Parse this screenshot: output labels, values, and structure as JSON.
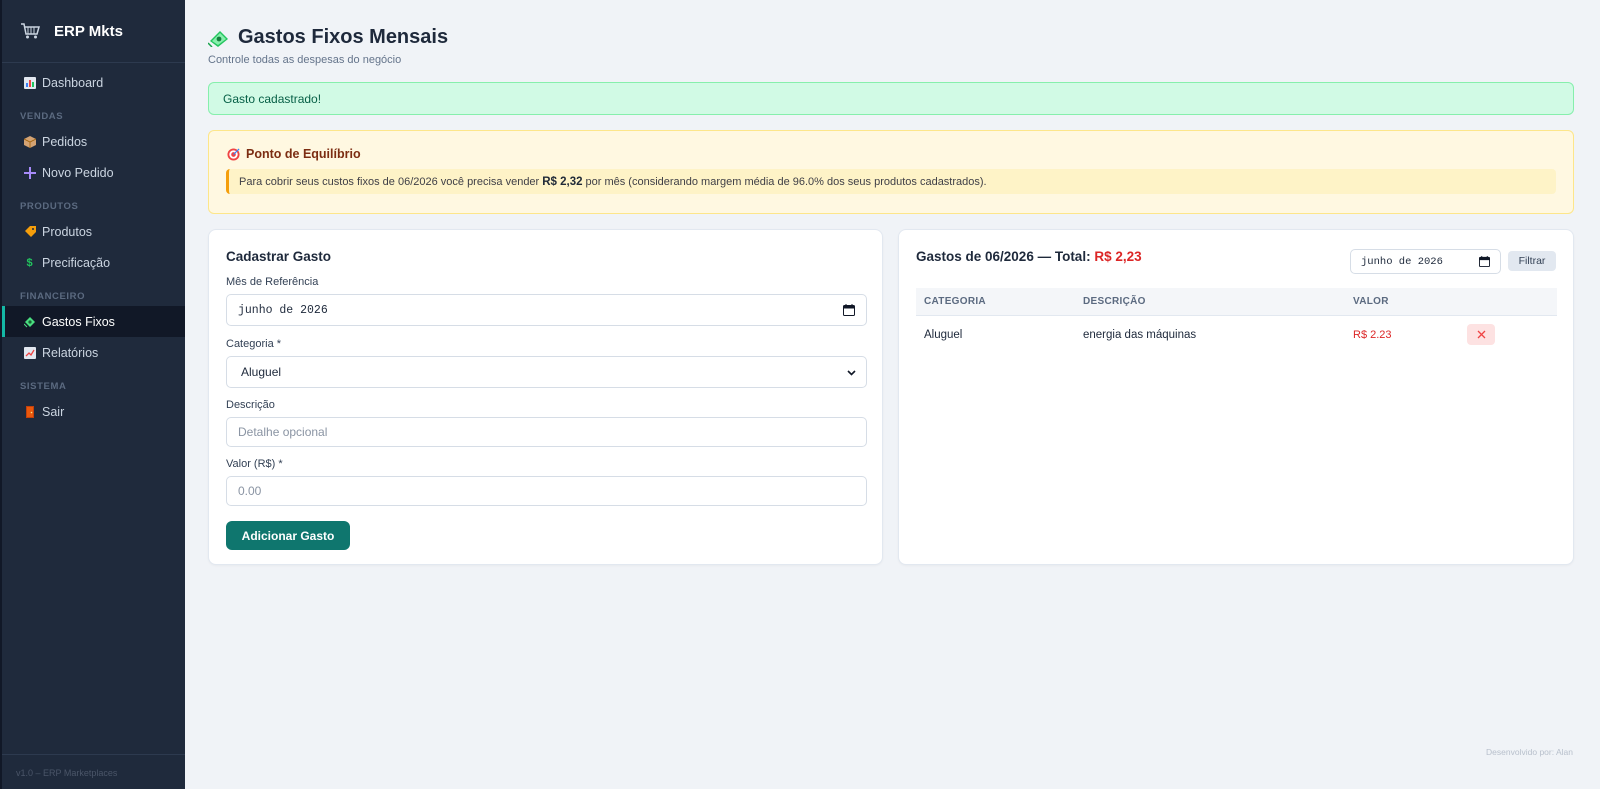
{
  "app": {
    "name": "ERP Mkts",
    "version": "v1.0 – ERP Marketplaces"
  },
  "sidebar": {
    "items": [
      {
        "label": "Dashboard",
        "icon": "chart-icon"
      },
      {
        "section": "VENDAS"
      },
      {
        "label": "Pedidos",
        "icon": "box-icon"
      },
      {
        "label": "Novo Pedido",
        "icon": "plus-icon"
      },
      {
        "section": "PRODUTOS"
      },
      {
        "label": "Produtos",
        "icon": "tag-icon"
      },
      {
        "label": "Precificação",
        "icon": "dollar-icon"
      },
      {
        "section": "FINANCEIRO"
      },
      {
        "label": "Gastos Fixos",
        "icon": "money-icon",
        "active": true
      },
      {
        "label": "Relatórios",
        "icon": "trend-icon"
      },
      {
        "section": "SISTEMA"
      },
      {
        "label": "Sair",
        "icon": "door-icon"
      }
    ]
  },
  "page": {
    "title": "Gastos Fixos Mensais",
    "subtitle": "Controle todas as despesas do negócio"
  },
  "alert": {
    "message": "Gasto cadastrado!"
  },
  "breakeven": {
    "title": "Ponto de Equilíbrio",
    "text_before": "Para cobrir seus custos fixos de 06/2026 você precisa vender",
    "amount": "R$ 2,32",
    "text_after": "por mês (considerando margem média de 96.0% dos seus produtos cadastrados)."
  },
  "form": {
    "title": "Cadastrar Gasto",
    "month_label": "Mês de Referência",
    "month_value": "junho de 2026",
    "category_label": "Categoria *",
    "category_value": "Aluguel",
    "description_label": "Descrição",
    "description_placeholder": "Detalhe opcional",
    "value_label": "Valor (R$) *",
    "value_placeholder": "0.00",
    "submit_label": "Adicionar Gasto"
  },
  "list": {
    "title_prefix": "Gastos de 06/2026 — Total:",
    "total": "R$ 2,23",
    "filter_date": "junho de 2026",
    "filter_label": "Filtrar",
    "columns": [
      "CATEGORIA",
      "DESCRIÇÃO",
      "VALOR"
    ],
    "rows": [
      {
        "categoria": "Aluguel",
        "descricao": "energia das máquinas",
        "valor": "R$ 2.23"
      }
    ]
  },
  "footer": {
    "credit": "Desenvolvido por: Alan"
  },
  "colors": {
    "sidebar": "#1f2a3c",
    "accent": "#0f766e",
    "danger": "#dc2626",
    "success_bg": "#d1fae5",
    "warning_bg": "#fff8e1"
  }
}
